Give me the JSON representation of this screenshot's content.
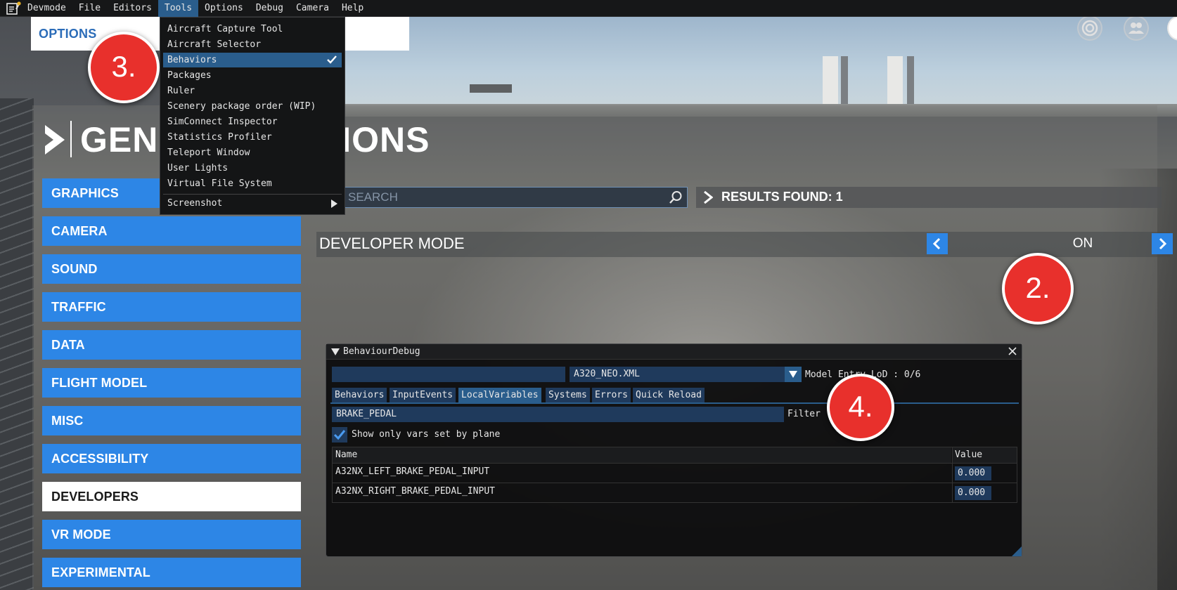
{
  "menubar": {
    "app_icon": "devmode-notepad-icon",
    "items": [
      {
        "label": "Devmode"
      },
      {
        "label": "File"
      },
      {
        "label": "Editors"
      },
      {
        "label": "Tools"
      },
      {
        "label": "Options"
      },
      {
        "label": "Debug"
      },
      {
        "label": "Camera"
      },
      {
        "label": "Help"
      }
    ],
    "open_item": "Tools"
  },
  "tools_menu": {
    "items": [
      {
        "label": "Aircraft Capture Tool"
      },
      {
        "label": "Aircraft Selector"
      },
      {
        "label": "Behaviors",
        "checked": true
      },
      {
        "label": "Packages"
      },
      {
        "label": "Ruler"
      },
      {
        "label": "Scenery package order (WIP)"
      },
      {
        "label": "SimConnect Inspector"
      },
      {
        "label": "Statistics Profiler"
      },
      {
        "label": "Teleport Window"
      },
      {
        "label": "User Lights"
      },
      {
        "label": "Virtual File System"
      }
    ],
    "submenu": {
      "label": "Screenshot"
    }
  },
  "header": {
    "options_label": "OPTIONS",
    "page_title": "GENERAL OPTIONS",
    "icons": [
      "activity-rings-icon",
      "users-icon",
      "profile-icon"
    ]
  },
  "sidebar": {
    "items": [
      {
        "label": "GRAPHICS"
      },
      {
        "label": "CAMERA"
      },
      {
        "label": "SOUND"
      },
      {
        "label": "TRAFFIC"
      },
      {
        "label": "DATA"
      },
      {
        "label": "FLIGHT MODEL"
      },
      {
        "label": "MISC"
      },
      {
        "label": "ACCESSIBILITY"
      },
      {
        "label": "DEVELOPERS",
        "active": true
      },
      {
        "label": "VR MODE"
      },
      {
        "label": "EXPERIMENTAL"
      }
    ]
  },
  "search": {
    "placeholder": "SEARCH",
    "results_label": "RESULTS FOUND: 1"
  },
  "developer_mode": {
    "label": "DEVELOPER MODE",
    "value": "ON"
  },
  "markers": {
    "m2": "2.",
    "m3": "3.",
    "m4": "4."
  },
  "behaviour_debug": {
    "title": "BehaviourDebug",
    "model_file": "A320_NEO.XML",
    "lod_label": "Model Entry LoD : 0/6",
    "tabs": [
      {
        "label": "Behaviors"
      },
      {
        "label": "InputEvents"
      },
      {
        "label": "LocalVariables",
        "active": true
      },
      {
        "label": "Systems"
      },
      {
        "label": "Errors"
      },
      {
        "label": "Quick Reload"
      }
    ],
    "filter_value": "BRAKE_PEDAL",
    "filter_label": "Filter",
    "checkbox_label": "Show only vars set by plane",
    "checkbox_checked": true,
    "columns": {
      "name": "Name",
      "value": "Value"
    },
    "rows": [
      {
        "name": "A32NX_LEFT_BRAKE_PEDAL_INPUT",
        "value": "0.000"
      },
      {
        "name": "A32NX_RIGHT_BRAKE_PEDAL_INPUT",
        "value": "0.000"
      }
    ]
  },
  "colors": {
    "accent_blue": "#2d86e6",
    "menu_highlight": "#2a5d8c",
    "marker_red": "#e8302c"
  }
}
